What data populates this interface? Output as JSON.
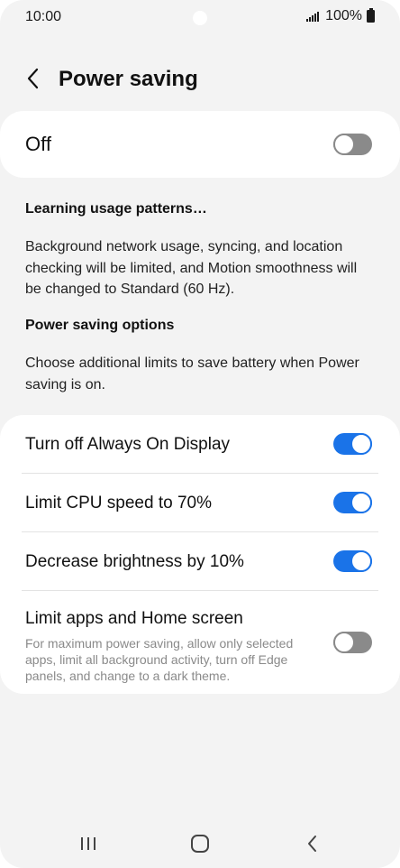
{
  "status_bar": {
    "time": "10:00",
    "battery_text": "100%"
  },
  "header": {
    "back_icon": "chevron-left-icon",
    "title": "Power saving"
  },
  "master_switch": {
    "label": "Off",
    "checked": false
  },
  "learning": {
    "heading": "Learning usage patterns…",
    "body": "Background network usage, syncing, and location checking will be limited, and Motion smoothness will be changed to Standard (60 Hz)."
  },
  "options_section": {
    "heading": "Power saving options",
    "body": "Choose additional limits to save battery when Power saving is on."
  },
  "options": [
    {
      "label": "Turn off Always On Display",
      "checked": true
    },
    {
      "label": "Limit CPU speed to 70%",
      "checked": true
    },
    {
      "label": "Decrease brightness by 10%",
      "checked": true
    },
    {
      "label": "Limit apps and Home screen",
      "description": "For maximum power saving, allow only selected apps, limit all background activity, turn off Edge panels, and change to a dark theme.",
      "checked": false
    }
  ],
  "navbar": {
    "recents_icon": "recents-icon",
    "home_icon": "home-icon",
    "back_icon": "back-icon"
  },
  "colors": {
    "accent": "#1a73e8",
    "toggle_off": "#8a8a8a",
    "background": "#f3f3f3",
    "card": "#ffffff"
  }
}
